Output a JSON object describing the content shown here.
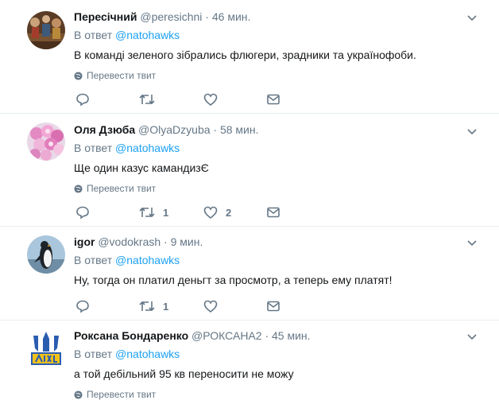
{
  "tweets": [
    {
      "name": "Пересічний",
      "handle": "@peresichni",
      "separator": "·",
      "time": "46 мин.",
      "reply_prefix": "В ответ",
      "reply_to": "@natohawks",
      "text": "В команді зеленого зібрались флюгери, зрадники та українофоби.",
      "translate": "Перевести твит",
      "retweets": "",
      "likes": ""
    },
    {
      "name": "Оля Дзюба",
      "handle": "@OlyaDzyuba",
      "separator": "·",
      "time": "58 мин.",
      "reply_prefix": "В ответ",
      "reply_to": "@natohawks",
      "text": "Ще один казус камандизЄ",
      "translate": "Перевести твит",
      "retweets": "1",
      "likes": "2"
    },
    {
      "name": "igor",
      "handle": "@vodokrash",
      "separator": "·",
      "time": "9 мин.",
      "reply_prefix": "В ответ",
      "reply_to": "@natohawks",
      "text": "Ну, тогда он платил деньгт за просмотр, а теперь ему платят!",
      "translate": "",
      "retweets": "1",
      "likes": ""
    },
    {
      "name": "Роксана Бондаренко",
      "handle": "@РОКСАНА2",
      "separator": "·",
      "time": "45 мин.",
      "reply_prefix": "В ответ",
      "reply_to": "@natohawks",
      "text": "а той дебільний 95 кв переносити не можу",
      "translate": "Перевести твит",
      "retweets": "",
      "likes": ""
    }
  ],
  "colors": {
    "link": "#1da1f2",
    "muted": "#657786",
    "text": "#14171a",
    "divider": "#e6ecf0"
  },
  "icons": [
    "reply-icon",
    "retweet-icon",
    "like-icon",
    "dm-icon",
    "globe-icon",
    "chevron-down-icon"
  ]
}
